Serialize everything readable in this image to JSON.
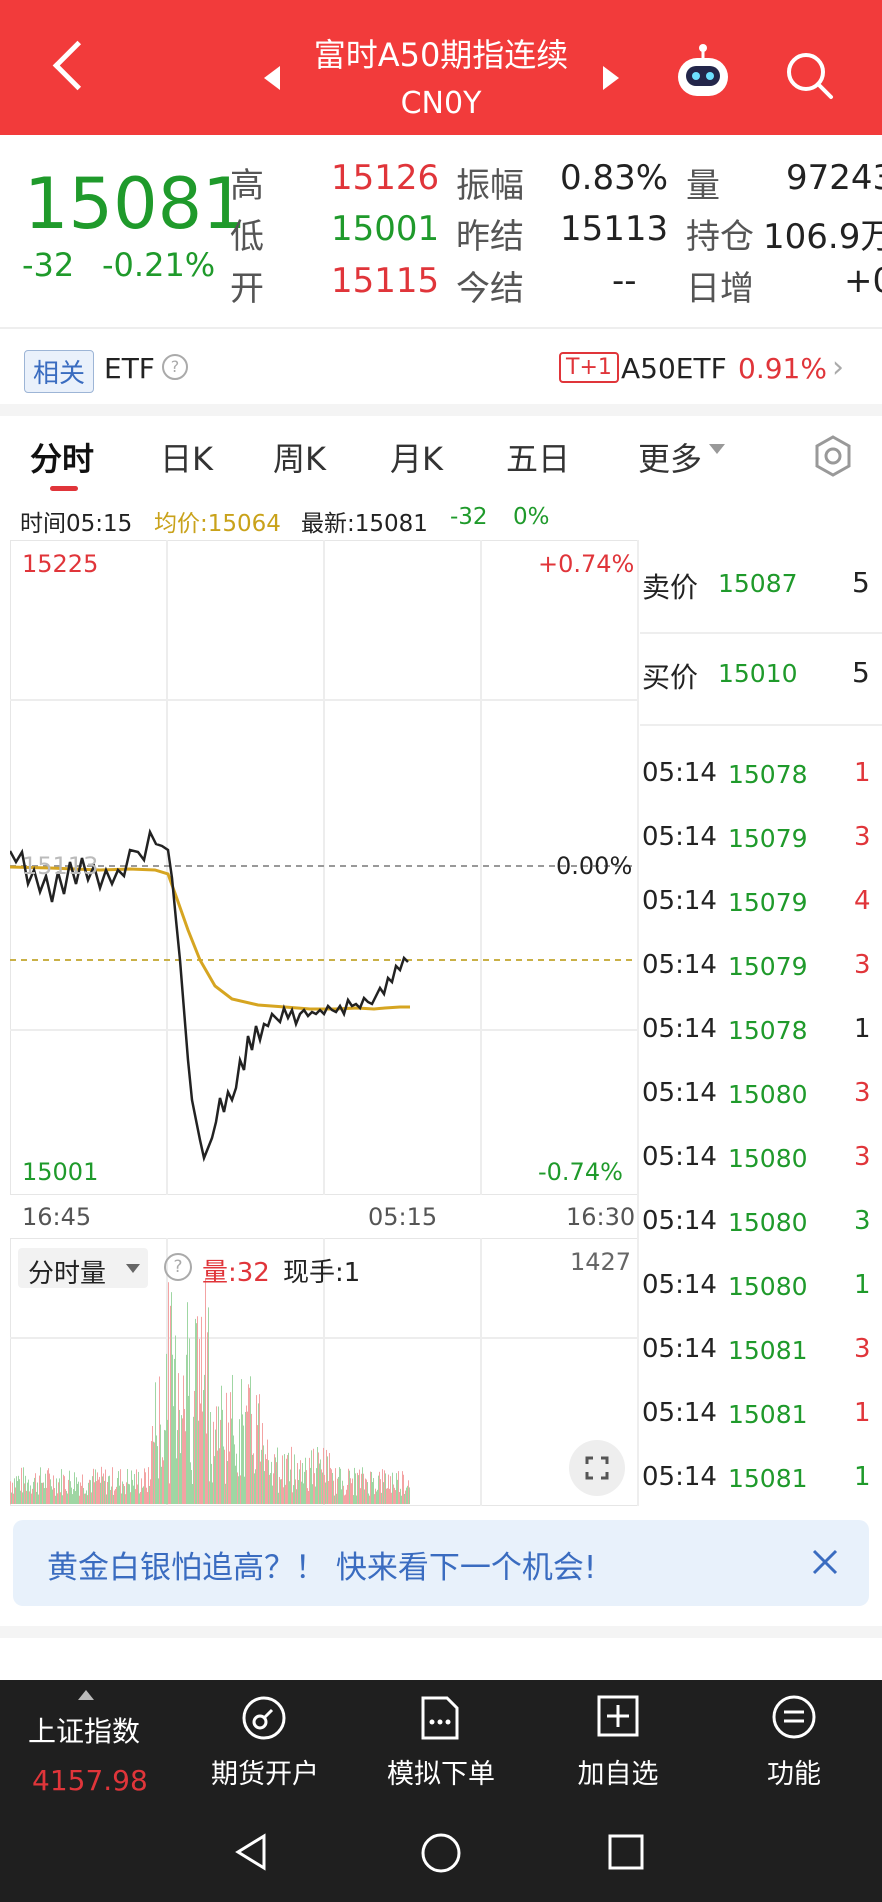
{
  "header": {
    "title": "富时A50期指连续",
    "code": "CN0Y"
  },
  "quote": {
    "price": "15081",
    "change": "-32",
    "change_pct": "-0.21%",
    "high_label": "高",
    "high": "15126",
    "low_label": "低",
    "low": "15001",
    "open_label": "开",
    "open": "15115",
    "amp_label": "振幅",
    "amp": "0.83%",
    "prev_settle_label": "昨结",
    "prev_settle": "15113",
    "settle_label": "今结",
    "settle": "--",
    "vol_label": "量",
    "vol": "97243",
    "oi_label": "持仓",
    "oi": "106.9万",
    "daily_inc_label": "日增",
    "daily_inc": "+0"
  },
  "etf": {
    "tag": "相关",
    "label": "ETF",
    "t1": "T+1",
    "name": "A50ETF",
    "pct": "0.91%"
  },
  "tabs": [
    "分时",
    "日K",
    "周K",
    "月K",
    "五日",
    "更多"
  ],
  "info_line": {
    "time": "时间05:15",
    "avg": "均价:15064",
    "latest": "最新:15081",
    "chg": "-32",
    "pct": "0%"
  },
  "chart": {
    "y_top": "15225",
    "y_top_pct": "+0.74%",
    "y_mid": "15113",
    "y_mid_pct": "0.00%",
    "y_bot": "15001",
    "y_bot_pct": "-0.74%",
    "x_left": "16:45",
    "x_mid": "05:15",
    "x_right": "16:30",
    "price_color": "#222222",
    "avg_color": "#d6a521"
  },
  "orderbook": {
    "ask_label": "卖价",
    "ask": "15087",
    "ask_vol": "5",
    "bid_label": "买价",
    "bid": "15010",
    "bid_vol": "5",
    "trades": [
      {
        "time": "05:14",
        "price": "15078",
        "vol": "1"
      },
      {
        "time": "05:14",
        "price": "15079",
        "vol": "3"
      },
      {
        "time": "05:14",
        "price": "15079",
        "vol": "4"
      },
      {
        "time": "05:14",
        "price": "15079",
        "vol": "3"
      },
      {
        "time": "05:14",
        "price": "15078",
        "vol": "1"
      },
      {
        "time": "05:14",
        "price": "15080",
        "vol": "3"
      },
      {
        "time": "05:14",
        "price": "15080",
        "vol": "3"
      },
      {
        "time": "05:14",
        "price": "15080",
        "vol": "3"
      },
      {
        "time": "05:14",
        "price": "15080",
        "vol": "1"
      },
      {
        "time": "05:14",
        "price": "15081",
        "vol": "3"
      },
      {
        "time": "05:14",
        "price": "15081",
        "vol": "1"
      },
      {
        "time": "05:14",
        "price": "15081",
        "vol": "1"
      }
    ]
  },
  "volume": {
    "selector": "分时量",
    "vol": "量:32",
    "hand": "现手:1",
    "max": "1427"
  },
  "banner": {
    "text": "黄金白银怕追高？！ 快来看下一个机会!"
  },
  "bottom": {
    "index_name": "上证指数",
    "index_value": "4157.98",
    "items": [
      "期货开户",
      "模拟下单",
      "加自选",
      "功能"
    ]
  }
}
